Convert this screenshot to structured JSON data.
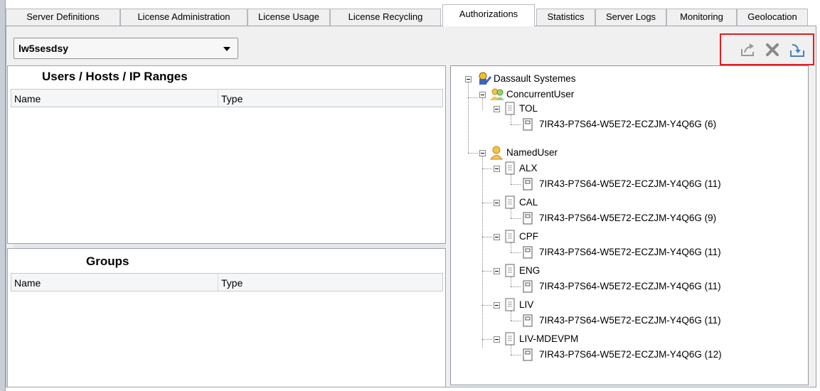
{
  "tabs": [
    {
      "label": "Server Definitions"
    },
    {
      "label": "License Administration"
    },
    {
      "label": "License Usage"
    },
    {
      "label": "License Recycling"
    },
    {
      "label": "Authorizations",
      "active": true
    },
    {
      "label": "Statistics"
    },
    {
      "label": "Server Logs"
    },
    {
      "label": "Monitoring"
    },
    {
      "label": "Geolocation"
    }
  ],
  "server_select": {
    "value": "lw5sesdsy"
  },
  "toolbar": {
    "icons": [
      "export-icon",
      "delete-icon",
      "import-icon"
    ],
    "highlight_color": "#e01c24"
  },
  "users_panel": {
    "title": "Users / Hosts / IP Ranges",
    "columns": [
      "Name",
      "Type"
    ]
  },
  "groups_panel": {
    "title": "Groups",
    "columns": [
      "Name",
      "Type"
    ]
  },
  "tree": {
    "root": "Dassault Systemes",
    "concurrent": "ConcurrentUser",
    "tol": "TOL",
    "tol_license": "7IR43-P7S64-W5E72-ECZJM-Y4Q6G (6)",
    "named": "NamedUser",
    "named_items": [
      {
        "name": "ALX",
        "license": "7IR43-P7S64-W5E72-ECZJM-Y4Q6G (11)"
      },
      {
        "name": "CAL",
        "license": "7IR43-P7S64-W5E72-ECZJM-Y4Q6G (9)"
      },
      {
        "name": "CPF",
        "license": "7IR43-P7S64-W5E72-ECZJM-Y4Q6G (11)"
      },
      {
        "name": "ENG",
        "license": "7IR43-P7S64-W5E72-ECZJM-Y4Q6G (11)"
      },
      {
        "name": "LIV",
        "license": "7IR43-P7S64-W5E72-ECZJM-Y4Q6G (11)"
      },
      {
        "name": "LIV-MDEVPM",
        "license": "7IR43-P7S64-W5E72-ECZJM-Y4Q6G (12)"
      }
    ]
  }
}
